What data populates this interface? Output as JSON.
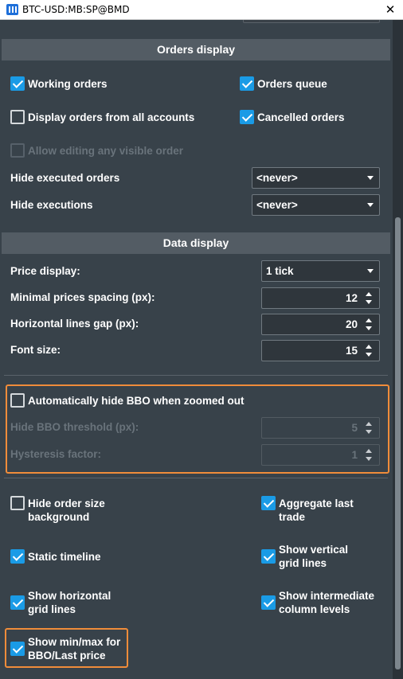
{
  "window": {
    "title": "BTC-USD:MB:SP@BMD",
    "close_glyph": "✕"
  },
  "orders_display": {
    "header": "Orders display",
    "working_orders": {
      "label": "Working orders",
      "checked": true
    },
    "orders_queue": {
      "label": "Orders queue",
      "checked": true
    },
    "display_all_accounts": {
      "label": "Display orders from all accounts",
      "checked": false
    },
    "cancelled_orders": {
      "label": "Cancelled orders",
      "checked": true
    },
    "allow_editing": {
      "label": "Allow editing any visible order",
      "checked": false,
      "disabled": true
    },
    "hide_executed_orders": {
      "label": "Hide executed orders",
      "value": "<never>"
    },
    "hide_executions": {
      "label": "Hide executions",
      "value": "<never>"
    }
  },
  "data_display": {
    "header": "Data display",
    "price_display": {
      "label": "Price display:",
      "value": "1 tick"
    },
    "minimal_prices_spacing": {
      "label": "Minimal prices spacing (px):",
      "value": "12"
    },
    "horizontal_lines_gap": {
      "label": "Horizontal lines gap (px):",
      "value": "20"
    },
    "font_size": {
      "label": "Font size:",
      "value": "15"
    }
  },
  "bbo": {
    "auto_hide": {
      "label": "Automatically hide BBO when zoomed out",
      "checked": false
    },
    "threshold": {
      "label": "Hide BBO threshold (px):",
      "value": "5",
      "disabled": true
    },
    "hysteresis": {
      "label": "Hysteresis factor:",
      "value": "1",
      "disabled": true
    }
  },
  "options": {
    "hide_order_size_bg": {
      "label_line1": "Hide order size",
      "label_line2": "background",
      "checked": false
    },
    "aggregate_last_trade": {
      "label_line1": "Aggregate last",
      "label_line2": "trade",
      "checked": true
    },
    "static_timeline": {
      "label": "Static timeline",
      "checked": true
    },
    "show_vertical_grid": {
      "label_line1": "Show vertical",
      "label_line2": "grid lines",
      "checked": true
    },
    "show_horizontal_grid": {
      "label_line1": "Show horizontal",
      "label_line2": "grid lines",
      "checked": true
    },
    "show_intermediate_levels": {
      "label_line1": "Show intermediate",
      "label_line2": "column levels",
      "checked": true
    },
    "show_minmax_bbo": {
      "label_line1": "Show min/max for",
      "label_line2": "BBO/Last price",
      "checked": true
    }
  },
  "colors": {
    "accent": "#1a9be6",
    "highlight": "#f08c3a",
    "background": "#38424a",
    "section_header": "#535c64"
  }
}
